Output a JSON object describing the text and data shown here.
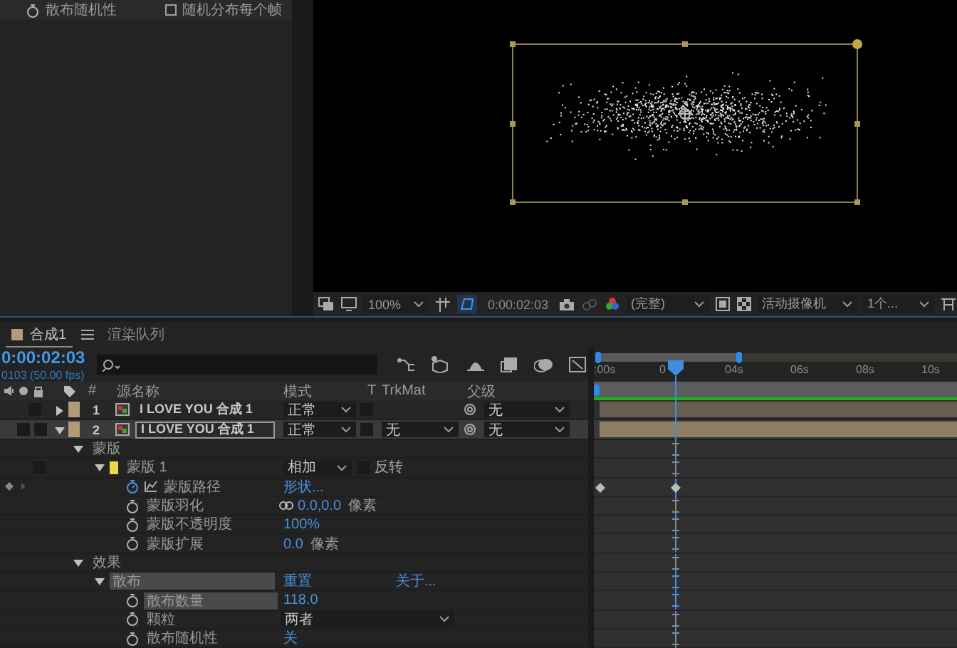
{
  "effect_controls": {
    "items": [
      {
        "kind": "stopwatch",
        "label": "散布随机性"
      },
      {
        "kind": "checkbox",
        "label": "随机分布每个帧",
        "checked": false
      }
    ]
  },
  "viewer": {
    "toolbar": {
      "zoom": "100%",
      "timecode": "0:00:02:03",
      "resolution": "(完整)",
      "camera": "活动摄像机",
      "views": "1个..."
    }
  },
  "timeline": {
    "tabs": [
      {
        "label": "合成1",
        "selected": true
      },
      {
        "label": "渲染队列",
        "selected": false
      }
    ],
    "timecode": "0:00:02:03",
    "frame_info": "0103 (50.00 fps)",
    "columns": {
      "number": "#",
      "source_name": "源名称",
      "mode": "模式",
      "t": "T",
      "trkmat": "TrkMat",
      "parent": "父级"
    },
    "ruler": [
      ":00s",
      "0",
      "04s",
      "06s",
      "08s",
      "10s"
    ],
    "layers": [
      {
        "number": "1",
        "name": "I LOVE YOU 合成 1",
        "mode": "正常",
        "parent": "无",
        "expanded": false,
        "selected": false
      },
      {
        "number": "2",
        "name": "I LOVE YOU 合成 1",
        "mode": "正常",
        "trkmat": "无",
        "parent": "无",
        "expanded": true,
        "selected": true
      }
    ],
    "properties": [
      {
        "kind": "group",
        "label": "蒙版",
        "expanded": true,
        "selected": false,
        "children": [
          {
            "kind": "mask",
            "label": "蒙版 1",
            "mode": "相加",
            "invert_label": "反转",
            "inverted": false,
            "expanded": true,
            "selected": false,
            "children": [
              {
                "kind": "keyed",
                "label": "蒙版路径",
                "value": "形状...",
                "selected": false
              },
              {
                "kind": "linked",
                "label": "蒙版羽化",
                "value": "0.0,0.0",
                "unit": "像素",
                "selected": false
              },
              {
                "kind": "property",
                "label": "蒙版不透明度",
                "value": "100%",
                "selected": false
              },
              {
                "kind": "property",
                "label": "蒙版扩展",
                "value": "0.0",
                "unit": "像素",
                "selected": false
              }
            ]
          }
        ]
      },
      {
        "kind": "group",
        "label": "效果",
        "expanded": true,
        "selected": false,
        "children": [
          {
            "kind": "effect",
            "label": "散布",
            "reset": "重置",
            "about": "关于...",
            "expanded": true,
            "selected": true,
            "children": [
              {
                "kind": "property",
                "label": "散布数量",
                "value": "118.0",
                "selected": true
              },
              {
                "kind": "dropdown",
                "label": "颗粒",
                "value": "两者",
                "selected": false
              },
              {
                "kind": "property",
                "label": "散布随机性",
                "value": "关",
                "selected": false
              }
            ]
          }
        ]
      }
    ]
  }
}
